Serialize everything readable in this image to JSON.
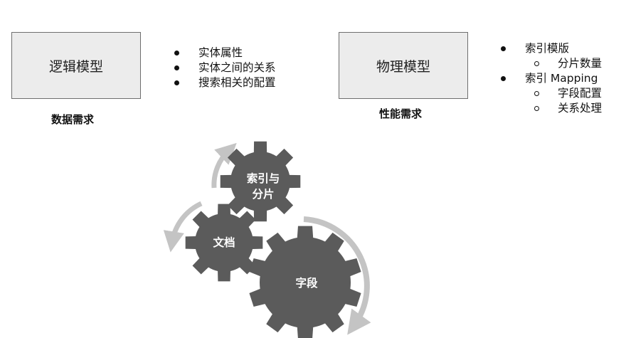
{
  "left_model": {
    "title": "逻辑模型",
    "caption": "数据需求",
    "bullets": [
      "实体属性",
      "实体之间的关系",
      "搜索相关的配置"
    ]
  },
  "right_model": {
    "title": "物理模型",
    "caption": "性能需求",
    "bullets": [
      {
        "text": "索引模版",
        "level": 1
      },
      {
        "text": "分片数量",
        "level": 2
      },
      {
        "text": "索引 Mapping",
        "level": 1
      },
      {
        "text": "字段配置",
        "level": 2
      },
      {
        "text": "关系处理",
        "level": 2
      }
    ]
  },
  "gears": {
    "index_sharding": {
      "line1": "索引与",
      "line2": "分片"
    },
    "document": "文档",
    "field": "字段",
    "gear_color": "#5b5b5b",
    "arrow_color": "#c4c4c4"
  }
}
